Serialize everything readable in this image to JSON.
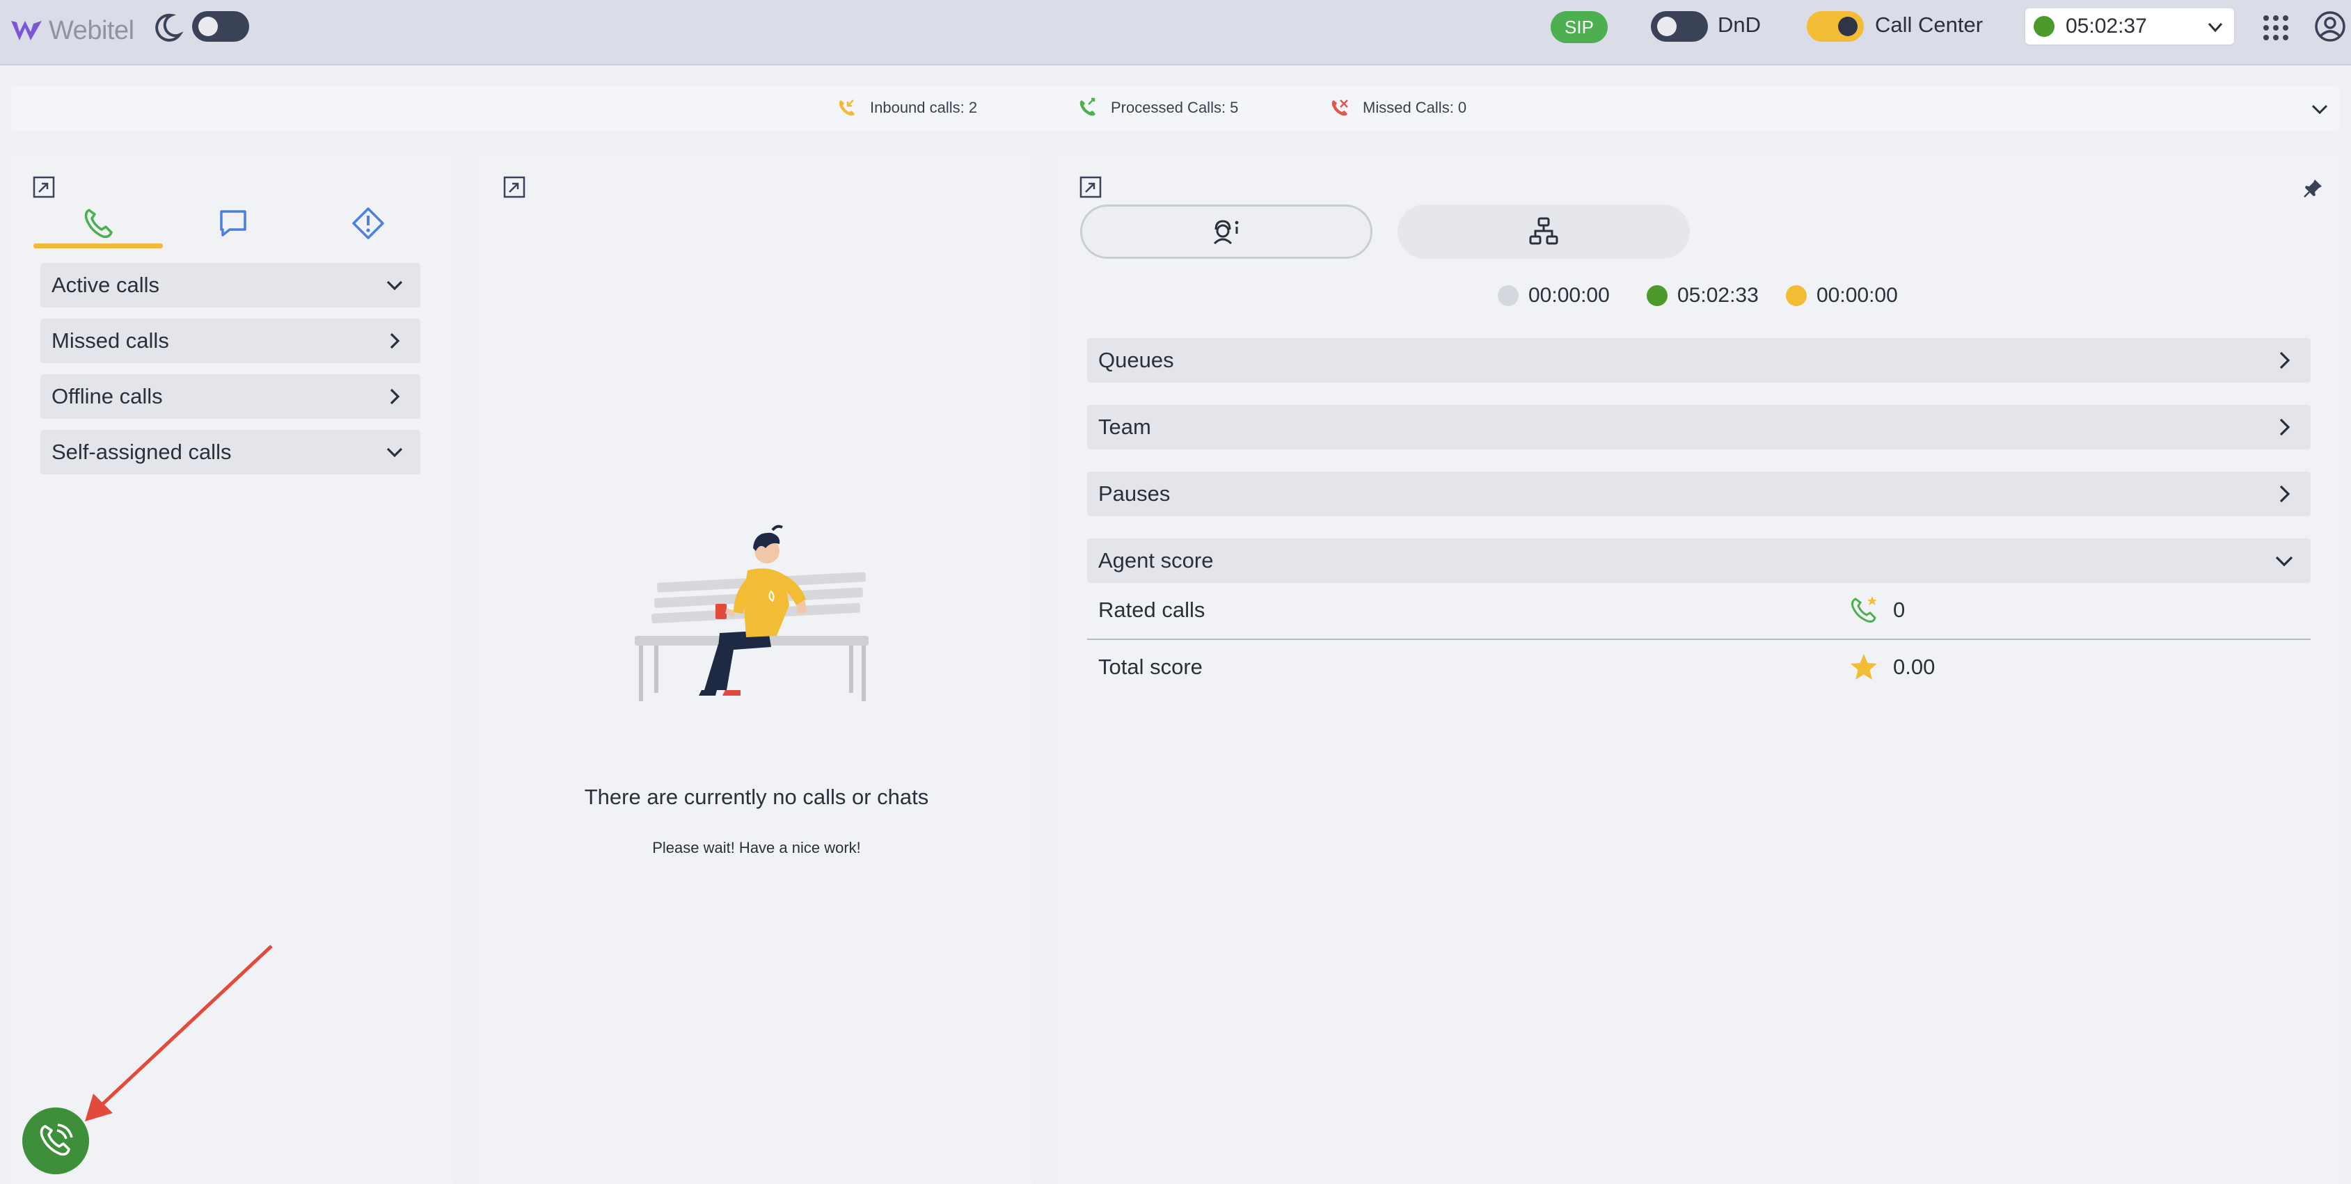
{
  "header": {
    "logo_text": "Webitel",
    "sip_label": "SIP",
    "dnd_label": "DnD",
    "call_center_label": "Call Center",
    "status_time": "05:02:37",
    "status_color": "#4c9a2a"
  },
  "stats": {
    "inbound": "Inbound calls: 2",
    "processed": "Processed Calls: 5",
    "missed": "Missed Calls: 0"
  },
  "left": {
    "tabs": [
      "phone-icon",
      "chat-icon",
      "alert-icon"
    ],
    "items": [
      {
        "label": "Active calls",
        "state": "expanded"
      },
      {
        "label": "Missed calls",
        "state": "collapsed"
      },
      {
        "label": "Offline calls",
        "state": "collapsed"
      },
      {
        "label": "Self-assigned calls",
        "state": "expanded"
      }
    ]
  },
  "middle": {
    "empty_title": "There are currently no calls or chats",
    "empty_subtitle": "Please wait! Have a nice work!"
  },
  "right": {
    "timers": [
      {
        "value": "00:00:00",
        "color": "#d5d7df"
      },
      {
        "value": "05:02:33",
        "color": "#4c9a2a"
      },
      {
        "value": "00:00:00",
        "color": "#f2bd35"
      }
    ],
    "sections": {
      "queues": "Queues",
      "team": "Team",
      "pauses": "Pauses",
      "agent_score": "Agent score"
    },
    "score": {
      "rated_calls_label": "Rated calls",
      "rated_calls_value": "0",
      "total_score_label": "Total score",
      "total_score_value": "0.00"
    }
  },
  "colors": {
    "accent": "#f2bd35",
    "green": "#4caf50",
    "dark": "#3a4257"
  }
}
